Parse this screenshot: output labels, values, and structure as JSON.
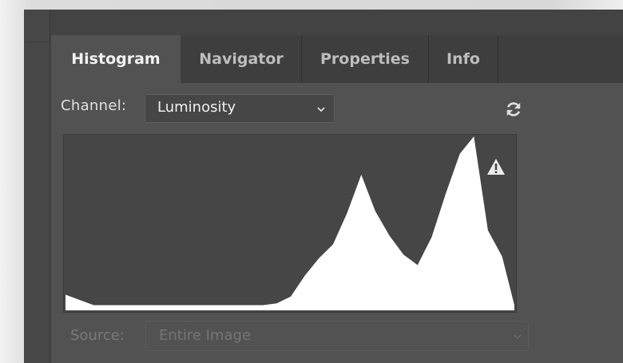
{
  "tabs": [
    {
      "label": "Histogram",
      "active": true
    },
    {
      "label": "Navigator",
      "active": false
    },
    {
      "label": "Properties",
      "active": false
    },
    {
      "label": "Info",
      "active": false
    }
  ],
  "channel": {
    "label": "Channel:",
    "selected": "Luminosity"
  },
  "source": {
    "label": "Source:",
    "selected": "Entire Image"
  },
  "icons": {
    "refresh": "refresh-icon",
    "warning": "warning-icon",
    "dropdown": "chevron-down-icon"
  },
  "histogram": {
    "channel": "Luminosity",
    "levels": [
      0,
      16,
      32,
      48,
      64,
      80,
      96,
      112,
      120,
      128,
      136,
      144,
      152,
      160,
      168,
      176,
      184,
      192,
      200,
      208,
      216,
      224,
      232,
      240,
      248,
      255
    ],
    "counts": [
      0.09,
      0.03,
      0.03,
      0.03,
      0.03,
      0.03,
      0.03,
      0.03,
      0.04,
      0.08,
      0.2,
      0.3,
      0.38,
      0.56,
      0.78,
      0.57,
      0.43,
      0.32,
      0.26,
      0.42,
      0.67,
      0.9,
      1.0,
      0.46,
      0.31,
      0.03
    ]
  },
  "colors": {
    "panel_bg": "#525252",
    "tabbar_bg": "#3e3e3e",
    "histogram_bg": "#464646",
    "histogram_fill": "#ffffff"
  }
}
